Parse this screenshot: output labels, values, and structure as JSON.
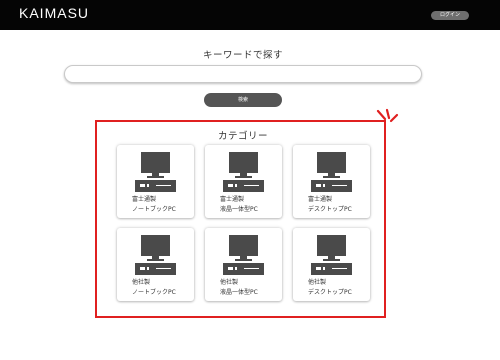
{
  "header": {
    "brand": "KAIMASU",
    "login_label": "ログイン"
  },
  "search": {
    "title": "キーワードで探す",
    "input_value": "",
    "button_label": "検索"
  },
  "category": {
    "title": "カテゴリー",
    "cards": [
      {
        "line1": "富士通製",
        "line2": "ノートブックPC",
        "icon": "desktop-pc-icon"
      },
      {
        "line1": "富士通製",
        "line2": "液晶一体型PC",
        "icon": "desktop-pc-icon"
      },
      {
        "line1": "富士通製",
        "line2": "デスクトップPC",
        "icon": "desktop-pc-icon"
      },
      {
        "line1": "他社製",
        "line2": "ノートブックPC",
        "icon": "desktop-pc-icon"
      },
      {
        "line1": "他社製",
        "line2": "液晶一体型PC",
        "icon": "desktop-pc-icon"
      },
      {
        "line1": "他社製",
        "line2": "デスクトップPC",
        "icon": "desktop-pc-icon"
      }
    ]
  },
  "colors": {
    "header_bg": "#050505",
    "highlight": "#e02020",
    "button_bg": "#555555",
    "icon": "#4a4a4a"
  }
}
